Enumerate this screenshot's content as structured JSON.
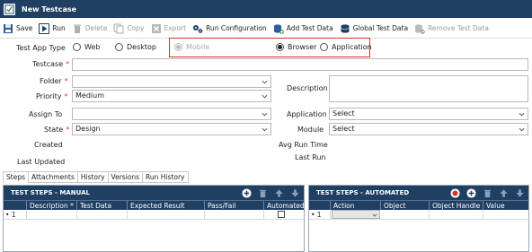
{
  "window": {
    "title": "New Testcase"
  },
  "toolbar": {
    "save": "Save",
    "run": "Run",
    "delete": "Delete",
    "copy": "Copy",
    "export": "Export",
    "run_configuration": "Run Configuration",
    "add_test_data": "Add Test Data",
    "global_test_data": "Global Test Data",
    "remove_test_data": "Remove Test Data"
  },
  "form": {
    "test_app_type_label": "Test App Type",
    "app_types": {
      "web": "Web",
      "desktop": "Desktop",
      "mobile": "Mobile",
      "browser": "Browser",
      "application": "Application"
    },
    "selected_app_type": "Browser",
    "testcase_label": "Testcase",
    "testcase_value": "",
    "folder_label": "Folder",
    "folder_value": "",
    "description_label": "Description",
    "priority_label": "Priority",
    "priority_value": "Medium",
    "assign_to_label": "Assign To",
    "assign_to_value": "",
    "application_label": "Application",
    "application_value": "Select",
    "state_label": "State",
    "state_value": "Design",
    "module_label": "Module",
    "module_value": "Select",
    "created_label": "Created",
    "avg_run_time_label": "Avg Run Time",
    "last_updated_label": "Last Updated",
    "last_run_label": "Last Run",
    "required_marker": "*"
  },
  "tabs": [
    "Steps",
    "Attachments",
    "History",
    "Versions",
    "Run History"
  ],
  "manual_panel": {
    "title": "TEST STEPS - MANUAL",
    "columns": [
      "",
      "Description *",
      "Test Data",
      "Expected Result",
      "Pass/Fail",
      "Automated"
    ],
    "rows": [
      {
        "marker": "• 1",
        "description": "",
        "test_data": "",
        "expected": "",
        "pass_fail": ""
      }
    ]
  },
  "automated_panel": {
    "title": "TEST STEPS - AUTOMATED",
    "columns": [
      "",
      "Action",
      "Object",
      "Object Handle",
      "Value"
    ],
    "rows": [
      {
        "marker": "• 1",
        "action": "",
        "object": "",
        "handle": "",
        "value": ""
      }
    ]
  },
  "colors": {
    "header_bg": "#1f3f63",
    "highlight": "#d9302c",
    "required": "#dd3333"
  }
}
